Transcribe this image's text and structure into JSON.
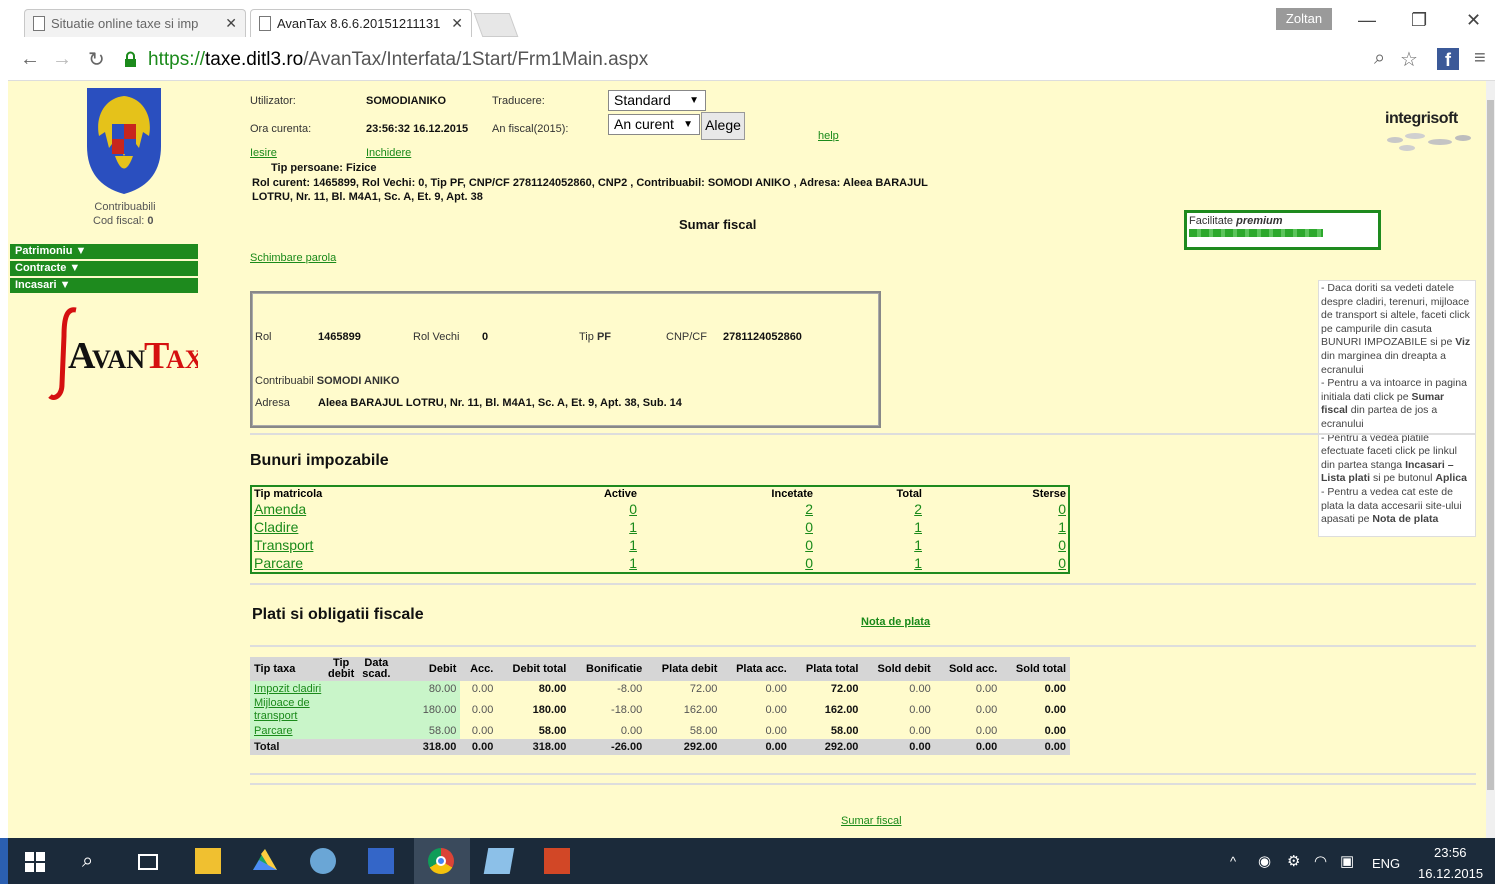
{
  "browser": {
    "tabs": [
      {
        "title": "Situatie online taxe si imp"
      },
      {
        "title": "AvanTax 8.6.6.20151211131"
      }
    ],
    "profile": "Zoltan",
    "url_scheme": "https://",
    "url_host": "taxe.ditl3.ro",
    "url_path": "/AvanTax/Interfata/1Start/Frm1Main.aspx"
  },
  "sidebar": {
    "contrib_label": "Contribuabili",
    "cod_fiscal_label": "Cod fiscal:",
    "cod_fiscal_value": "0",
    "menu": [
      "Patrimoniu",
      "Contracte",
      "Incasari"
    ],
    "logo_text": "AVANTAX"
  },
  "header": {
    "utilizator_label": "Utilizator:",
    "utilizator_value": "SOMODIANIKO",
    "traducere_label": "Traducere:",
    "traducere_value": "Standard",
    "ora_label": "Ora curenta:",
    "ora_value": "23:56:32 16.12.2015",
    "anfiscal_label": "An fiscal(2015):",
    "anfiscal_value": "An curent",
    "alege_label": "Alege",
    "help_label": "help",
    "iesire_label": "Iesire",
    "inchidere_label": "Inchidere",
    "tip_persoane": "Tip persoane: Fizice",
    "rol_line1": "Rol curent: 1465899, Rol Vechi: 0, Tip PF, CNP/CF 2781124052860, CNP2 , Contribuabil: SOMODI ANIKO , Adresa: Aleea BARAJUL",
    "rol_line2": "LOTRU, Nr. 11, Bl. M4A1, Sc. A, Et. 9, Apt. 38",
    "sumar_title": "Sumar fiscal",
    "schimbare_parola": "Schimbare parola",
    "integrisoft": "integrisoft",
    "premium_label": "Facilitate",
    "premium_em": "premium"
  },
  "info_box": {
    "rol_label": "Rol",
    "rol_value": "1465899",
    "rolvechi_label": "Rol Vechi",
    "rolvechi_value": "0",
    "tip_label": "Tip",
    "tip_value": "PF",
    "cnp_label": "CNP/CF",
    "cnp_value": "2781124052860",
    "contrib_label": "Contribuabil",
    "contrib_value": "SOMODI ANIKO",
    "adresa_label": "Adresa",
    "adresa_value": "Aleea BARAJUL LOTRU, Nr. 11, Bl. M4A1, Sc. A, Et. 9, Apt. 38, Sub. 14"
  },
  "help_text": {
    "p1": "- Daca doriti sa vedeti datele despre cladiri, terenuri, mijloace de transport si altele, faceti click pe campurile din casuta BUNURI IMPOZABILE si pe",
    "p1b": "Viz",
    "p1c": "din marginea din dreapta a ecranului",
    "p2": "- Pentru a va intoarce in pagina initiala dati click pe",
    "p2b": "Sumar fiscal",
    "p2c": "din partea de jos a ecranului",
    "p3": "- Pentru a vedea platile efectuate faceti click pe linkul din partea stanga",
    "p3b": "Incasari – Lista plati",
    "p3c": "si pe butonul",
    "p3d": "Aplica",
    "p4": "- Pentru a vedea cat este de plata la data accesarii site-ului apasati pe",
    "p4b": "Nota de plata"
  },
  "bunuri": {
    "title": "Bunuri impozabile",
    "headers": [
      "Tip matricola",
      "Active",
      "Incetate",
      "Total",
      "Sterse"
    ],
    "rows": [
      {
        "tip": "Amenda",
        "active": "0",
        "incetate": "2",
        "total": "2",
        "sterse": "0"
      },
      {
        "tip": "Cladire",
        "active": "1",
        "incetate": "0",
        "total": "1",
        "sterse": "1"
      },
      {
        "tip": "Transport",
        "active": "1",
        "incetate": "0",
        "total": "1",
        "sterse": "0"
      },
      {
        "tip": "Parcare",
        "active": "1",
        "incetate": "0",
        "total": "1",
        "sterse": "0"
      }
    ]
  },
  "plati": {
    "title": "Plati si obligatii fiscale",
    "nota_de_plata": "Nota de plata",
    "headers": [
      "Tip taxa",
      "Tip debit",
      "Data scad.",
      "Debit",
      "Acc.",
      "Debit total",
      "Bonificatie",
      "Plata debit",
      "Plata acc.",
      "Plata total",
      "Sold debit",
      "Sold acc.",
      "Sold total"
    ],
    "rows": [
      {
        "tip": "Impozit cladiri",
        "debit": "80.00",
        "acc": "0.00",
        "debit_total": "80.00",
        "bonif": "-8.00",
        "plata_debit": "72.00",
        "plata_acc": "0.00",
        "plata_total": "72.00",
        "sold_debit": "0.00",
        "sold_acc": "0.00",
        "sold_total": "0.00"
      },
      {
        "tip": "Mijloace de transport",
        "debit": "180.00",
        "acc": "0.00",
        "debit_total": "180.00",
        "bonif": "-18.00",
        "plata_debit": "162.00",
        "plata_acc": "0.00",
        "plata_total": "162.00",
        "sold_debit": "0.00",
        "sold_acc": "0.00",
        "sold_total": "0.00"
      },
      {
        "tip": "Parcare",
        "debit": "58.00",
        "acc": "0.00",
        "debit_total": "58.00",
        "bonif": "0.00",
        "plata_debit": "58.00",
        "plata_acc": "0.00",
        "plata_total": "58.00",
        "sold_debit": "0.00",
        "sold_acc": "0.00",
        "sold_total": "0.00"
      }
    ],
    "total": {
      "tip": "Total",
      "debit": "318.00",
      "acc": "0.00",
      "debit_total": "318.00",
      "bonif": "-26.00",
      "plata_debit": "292.00",
      "plata_acc": "0.00",
      "plata_total": "292.00",
      "sold_debit": "0.00",
      "sold_acc": "0.00",
      "sold_total": "0.00"
    },
    "footer_link": "Sumar fiscal"
  },
  "taskbar": {
    "lang": "ENG",
    "time": "23:56",
    "date": "16.12.2015"
  }
}
